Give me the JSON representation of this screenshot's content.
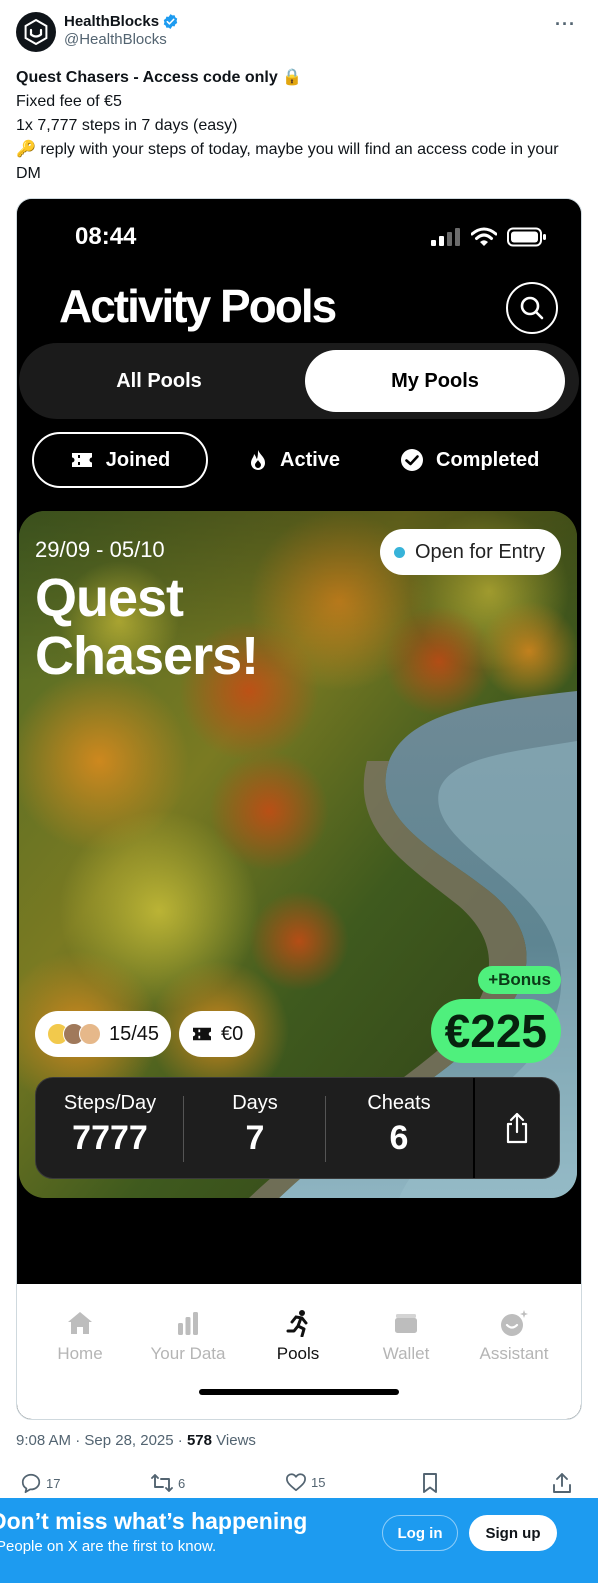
{
  "tweet": {
    "author_name": "HealthBlocks",
    "author_handle": "@HealthBlocks",
    "verified": true,
    "more_icon": "more-horizontal-icon",
    "text": {
      "title": "Quest Chasers - Access code only",
      "title_emoji": "🔒",
      "line2": "Fixed fee of €5",
      "line3": "1x 7,777 steps in 7 days (easy)",
      "line4_emoji": "🔑",
      "line4": "reply with your steps of today, maybe you will find an access code in your DM"
    },
    "timestamp": "9:08 AM · Sep 28, 2025 ·",
    "views_count": "578",
    "views_label": "Views",
    "actions": {
      "replies": "17",
      "reposts": "6",
      "likes": "15"
    }
  },
  "app": {
    "status_time": "08:44",
    "title": "Activity Pools",
    "segments": {
      "all": "All Pools",
      "mine": "My Pools",
      "selected": "mine"
    },
    "filters": {
      "joined": "Joined",
      "active": "Active",
      "completed": "Completed",
      "selected": "joined"
    },
    "pool": {
      "dates": "29/09 - 05/10",
      "name": "Quest Chasers!",
      "status": "Open for Entry",
      "participants": "15/45",
      "entry_fee": "€0",
      "bonus_label": "+Bonus",
      "prize": "€225",
      "stats": [
        {
          "label": "Steps/Day",
          "value": "7777"
        },
        {
          "label": "Days",
          "value": "7"
        },
        {
          "label": "Cheats",
          "value": "6"
        }
      ]
    },
    "tabs": [
      {
        "label": "Home",
        "icon": "home-icon"
      },
      {
        "label": "Your Data",
        "icon": "bar-chart-icon"
      },
      {
        "label": "Pools",
        "icon": "running-person-icon",
        "active": true
      },
      {
        "label": "Wallet",
        "icon": "wallet-icon"
      },
      {
        "label": "Assistant",
        "icon": "assistant-icon"
      }
    ]
  },
  "banner": {
    "title": "Don’t miss what’s happening",
    "subtitle": "People on X are the first to know.",
    "login": "Log in",
    "signup": "Sign up"
  },
  "colors": {
    "x_blue": "#1d9bf0",
    "prize_green": "#4ff07d",
    "status_dot": "#37b3d9"
  }
}
